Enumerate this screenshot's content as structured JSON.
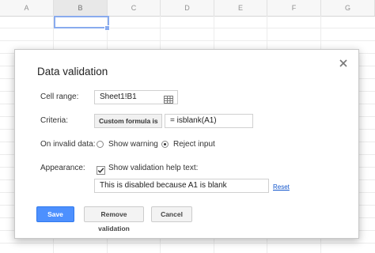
{
  "sheet": {
    "columns": [
      "A",
      "B",
      "C",
      "D",
      "E",
      "F",
      "G"
    ],
    "active_column": "B"
  },
  "dialog": {
    "title": "Data validation",
    "cell_range": {
      "label": "Cell range:",
      "value": "Sheet1!B1"
    },
    "criteria": {
      "label": "Criteria:",
      "type": "Custom formula is",
      "formula": "= isblank(A1)"
    },
    "invalid": {
      "label": "On invalid data:",
      "options": [
        {
          "label": "Show warning",
          "selected": false
        },
        {
          "label": "Reject input",
          "selected": true
        }
      ]
    },
    "appearance": {
      "label": "Appearance:",
      "checkbox_label": "Show validation help text:",
      "checked": true,
      "help_text": "This is disabled because A1 is blank",
      "reset_label": "Reset"
    },
    "buttons": {
      "save": "Save",
      "remove": "Remove validation",
      "cancel": "Cancel"
    }
  },
  "colors": {
    "accent": "#4d90fe",
    "selection": "#4a7fe5",
    "link": "#1155cc"
  }
}
